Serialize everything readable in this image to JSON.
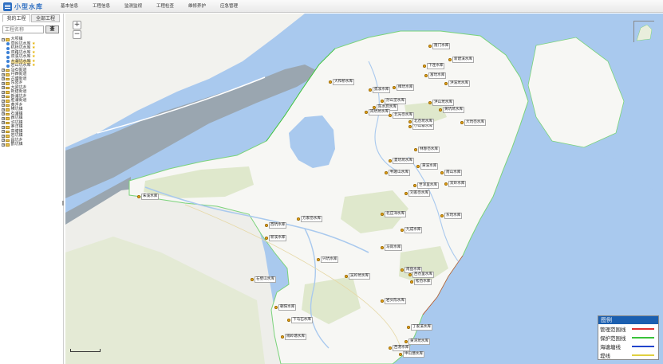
{
  "app": {
    "title": "小型水库",
    "logo_icon": "grid-menu-icon"
  },
  "menu": [
    {
      "label": "基本信息"
    },
    {
      "label": "工程信息"
    },
    {
      "label": "监测监视"
    },
    {
      "label": "工程检查"
    },
    {
      "label": "维修养护"
    },
    {
      "label": "应急管理"
    }
  ],
  "sidebar": {
    "tabs": [
      {
        "label": "我的工程"
      },
      {
        "label": "全部工程"
      }
    ],
    "search": {
      "placeholder": "工程名称",
      "button_label": "查"
    },
    "tree": [
      {
        "label": "大坝镇",
        "type": "folder",
        "level": 0,
        "expanded": true
      },
      {
        "label": "草岭坑水库",
        "type": "item",
        "level": 1,
        "star": true
      },
      {
        "label": "杭桥坑水库",
        "type": "item",
        "level": 1,
        "star": true
      },
      {
        "label": "双路坑水库",
        "type": "item",
        "level": 1,
        "star": true
      },
      {
        "label": "双溪坑水库",
        "type": "item",
        "level": 1,
        "star": true
      },
      {
        "label": "大湖坑水库",
        "type": "item",
        "level": 1,
        "star": true,
        "selected": true
      },
      {
        "label": "岩山坑水库",
        "type": "item",
        "level": 1,
        "star": true
      },
      {
        "label": "乌石街道",
        "type": "folder",
        "level": 0
      },
      {
        "label": "丹西街道",
        "type": "folder",
        "level": 0
      },
      {
        "label": "古塘街道",
        "type": "folder",
        "level": 0
      },
      {
        "label": "东阳乡",
        "type": "folder",
        "level": 0
      },
      {
        "label": "大梁坑乡",
        "type": "folder",
        "level": 0
      },
      {
        "label": "新建街道",
        "type": "folder",
        "level": 0
      },
      {
        "label": "新浦坑乡",
        "type": "folder",
        "level": 0
      },
      {
        "label": "胜浦街道",
        "type": "folder",
        "level": 0
      },
      {
        "label": "黄浮乡",
        "type": "folder",
        "level": 0
      },
      {
        "label": "横坑镇",
        "type": "folder",
        "level": 0
      },
      {
        "label": "石浦镇",
        "type": "folder",
        "level": 0
      },
      {
        "label": "西坑镇",
        "type": "folder",
        "level": 0
      },
      {
        "label": "浒坑镇",
        "type": "folder",
        "level": 0
      },
      {
        "label": "茅洋镇",
        "type": "folder",
        "level": 0
      },
      {
        "label": "高塘镇",
        "type": "folder",
        "level": 0
      },
      {
        "label": "岩坑镇",
        "type": "folder",
        "level": 0
      },
      {
        "label": "昌坑乡",
        "type": "folder",
        "level": 0
      },
      {
        "label": "鹤坑镇",
        "type": "folder",
        "level": 0
      }
    ]
  },
  "map": {
    "zoom_in_label": "+",
    "zoom_out_label": "−",
    "colors": {
      "sea": "#a9c9ee",
      "land": "#f7f7f4",
      "green": "#dfe8cc",
      "river": "#a9c9ee",
      "tidal": "#9aa6b0"
    },
    "reservoirs": [
      {
        "label": "隆门水库"
      },
      {
        "label": "新建溪水库"
      },
      {
        "label": "下连水库"
      },
      {
        "label": "富坑水库"
      },
      {
        "label": "大和桥水库"
      },
      {
        "label": "洪溪坑水库"
      },
      {
        "label": "孤溪水库"
      },
      {
        "label": "樟坑水库"
      },
      {
        "label": "孙山垄水库"
      },
      {
        "label": "洪山坑水库"
      },
      {
        "label": "陈水后水库"
      },
      {
        "label": "黄坑坑水库"
      },
      {
        "label": "岗坑坑水库"
      },
      {
        "label": "北光岙水库"
      },
      {
        "label": "小山寨水库"
      },
      {
        "label": "大坑岙水库"
      },
      {
        "label": "北岙坑水库"
      },
      {
        "label": "林春岙水库"
      },
      {
        "label": "夏坑坑水库"
      },
      {
        "label": "黄溪水库"
      },
      {
        "label": "鸭葛山水库"
      },
      {
        "label": "南山水库"
      },
      {
        "label": "世洋里水库"
      },
      {
        "label": "双岭水库"
      },
      {
        "label": "刘家岙水库"
      },
      {
        "label": "朱溪水库"
      },
      {
        "label": "东坑水库"
      },
      {
        "label": "方家岙水库"
      },
      {
        "label": "北庄洋水库"
      },
      {
        "label": "西坑水库"
      },
      {
        "label": "九成水库"
      },
      {
        "label": "新溪水库"
      },
      {
        "label": "马岗水库"
      },
      {
        "label": "兴坑水库"
      },
      {
        "label": "南盘水库"
      },
      {
        "label": "吴岭坑水库"
      },
      {
        "label": "西岙里水库"
      },
      {
        "label": "石壁山水库"
      },
      {
        "label": "松岙水库"
      },
      {
        "label": "岩头陈水库"
      },
      {
        "label": "朝阳水库"
      },
      {
        "label": "下马石水库"
      },
      {
        "label": "丁家溪水库"
      },
      {
        "label": "隔岭塘水库"
      },
      {
        "label": "黄湾坑水库"
      },
      {
        "label": "西港水库"
      },
      {
        "label": "中山塘水库"
      }
    ]
  },
  "legend": {
    "title": "图例",
    "items": [
      {
        "label": "管理范围线",
        "color": "#e03030"
      },
      {
        "label": "保护范围线",
        "color": "#39c239"
      },
      {
        "label": "海塘塘线",
        "color": "#2244cc"
      },
      {
        "label": "堤线",
        "color": "#e0d040"
      }
    ]
  }
}
